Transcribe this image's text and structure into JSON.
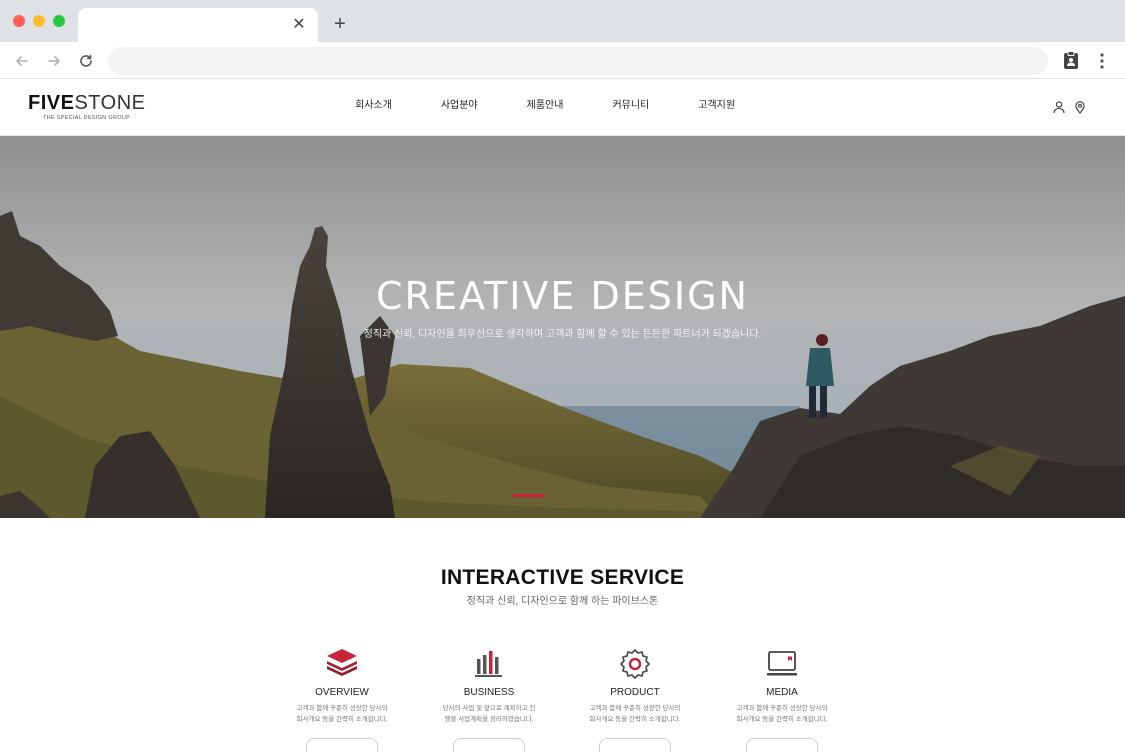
{
  "browser": {
    "tab_close": "✕",
    "new_tab": "+"
  },
  "site": {
    "logo_bold": "FIVE",
    "logo_light": "STONE",
    "logo_tagline": "THE SPECIAL DESIGN GROUP",
    "nav": [
      "회사소개",
      "사업분야",
      "제품안내",
      "커뮤니티",
      "고객지원"
    ]
  },
  "hero": {
    "title": "CREATIVE DESIGN",
    "subtitle": "정직과 신뢰, 디자인을 최우선으로 생각하며 고객과 함께 할 수 있는 든든한 파트너가 되겠습니다.",
    "indicator_color": "#c8253a"
  },
  "services": {
    "title": "INTERACTIVE SERVICE",
    "subtitle": "정직과 신뢰, 디자인으로 함께 하는 파이브스톤",
    "accent": "#c8253a",
    "items": [
      {
        "icon": "layers-icon",
        "title": "OVERVIEW",
        "desc_line1": "고객과 함께 꾸준히 성장한 당사의",
        "desc_line2": "회사개요 등을 간략히 소개합니다."
      },
      {
        "icon": "bar-chart-icon",
        "title": "BUSINESS",
        "desc_line1": "당사의 사업 및 앞으로 계획하고 진",
        "desc_line2": "행할 사업계획을 정리하였습니다."
      },
      {
        "icon": "gear-icon",
        "title": "PRODUCT",
        "desc_line1": "고객과 함께 꾸준히 성장한 당사의",
        "desc_line2": "회사개요 등을 간략히 소개합니다."
      },
      {
        "icon": "monitor-icon",
        "title": "MEDIA",
        "desc_line1": "고객과 함께 꾸준히 성장한 당사의",
        "desc_line2": "회사개요 등을 간략히 소개합니다."
      }
    ]
  }
}
